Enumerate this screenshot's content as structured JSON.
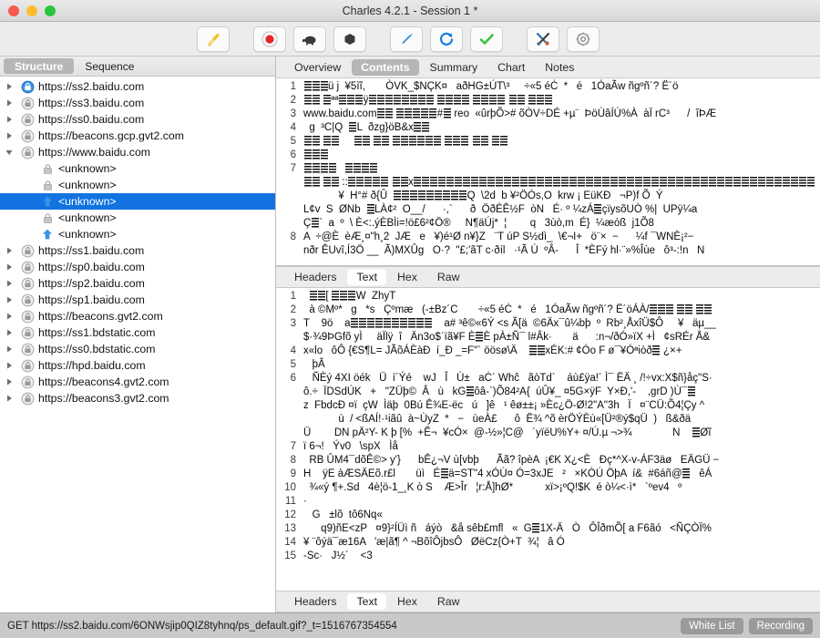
{
  "window": {
    "title": "Charles 4.2.1 - Session 1 *",
    "lights": [
      "close",
      "minimize",
      "zoom"
    ]
  },
  "toolbar": {
    "buttons": [
      {
        "name": "clear-session-button",
        "icon": "broom-icon",
        "label": "Clear"
      },
      {
        "name": "record-button",
        "icon": "record-icon",
        "label": "Start/Stop Recording"
      },
      {
        "name": "throttle-button",
        "icon": "turtle-icon",
        "label": "Throttle Settings"
      },
      {
        "name": "breakpoint-button",
        "icon": "hexagon-icon",
        "label": "Breakpoints"
      },
      {
        "name": "compose-button",
        "icon": "pen-icon",
        "label": "Compose"
      },
      {
        "name": "repeat-button",
        "icon": "refresh-icon",
        "label": "Repeat"
      },
      {
        "name": "validate-button",
        "icon": "checkmark-icon",
        "label": "Validate"
      },
      {
        "name": "tools-button",
        "icon": "tools-icon",
        "label": "Tools"
      },
      {
        "name": "settings-button",
        "icon": "gear-icon",
        "label": "Settings"
      }
    ]
  },
  "sidebar": {
    "segments": [
      {
        "label": "Structure",
        "active": true
      },
      {
        "label": "Sequence",
        "active": false
      }
    ],
    "tree": [
      {
        "label": "https://ss2.baidu.com",
        "icon": "globe-icon",
        "twisty": "collapsed",
        "depth": 0,
        "selected": false
      },
      {
        "label": "https://ss3.baidu.com",
        "icon": "lock-icon",
        "twisty": "collapsed",
        "depth": 0,
        "selected": false
      },
      {
        "label": "https://ss0.baidu.com",
        "icon": "lock-icon",
        "twisty": "collapsed",
        "depth": 0,
        "selected": false
      },
      {
        "label": "https://beacons.gcp.gvt2.com",
        "icon": "lock-icon",
        "twisty": "collapsed",
        "depth": 0,
        "selected": false
      },
      {
        "label": "https://www.baidu.com",
        "icon": "lock-icon",
        "twisty": "expanded",
        "depth": 0,
        "selected": false
      },
      {
        "label": "<unknown>",
        "icon": "lock-small-icon",
        "twisty": "none",
        "depth": 1,
        "selected": false
      },
      {
        "label": "<unknown>",
        "icon": "lock-small-icon",
        "twisty": "none",
        "depth": 1,
        "selected": false
      },
      {
        "label": "<unknown>",
        "icon": "upload-arrow-icon",
        "twisty": "none",
        "depth": 1,
        "selected": true
      },
      {
        "label": "<unknown>",
        "icon": "lock-small-icon",
        "twisty": "none",
        "depth": 1,
        "selected": false
      },
      {
        "label": "<unknown>",
        "icon": "upload-arrow-icon",
        "twisty": "none",
        "depth": 1,
        "selected": false
      },
      {
        "label": "https://ss1.baidu.com",
        "icon": "lock-icon",
        "twisty": "collapsed",
        "depth": 0,
        "selected": false
      },
      {
        "label": "https://sp0.baidu.com",
        "icon": "lock-icon",
        "twisty": "collapsed",
        "depth": 0,
        "selected": false
      },
      {
        "label": "https://sp2.baidu.com",
        "icon": "lock-icon",
        "twisty": "collapsed",
        "depth": 0,
        "selected": false
      },
      {
        "label": "https://sp1.baidu.com",
        "icon": "lock-icon",
        "twisty": "collapsed",
        "depth": 0,
        "selected": false
      },
      {
        "label": "https://beacons.gvt2.com",
        "icon": "lock-icon",
        "twisty": "collapsed",
        "depth": 0,
        "selected": false
      },
      {
        "label": "https://ss1.bdstatic.com",
        "icon": "lock-icon",
        "twisty": "collapsed",
        "depth": 0,
        "selected": false
      },
      {
        "label": "https://ss0.bdstatic.com",
        "icon": "lock-icon",
        "twisty": "collapsed",
        "depth": 0,
        "selected": false
      },
      {
        "label": "https://hpd.baidu.com",
        "icon": "lock-icon",
        "twisty": "collapsed",
        "depth": 0,
        "selected": false
      },
      {
        "label": "https://beacons4.gvt2.com",
        "icon": "lock-icon",
        "twisty": "collapsed",
        "depth": 0,
        "selected": false
      },
      {
        "label": "https://beacons3.gvt2.com",
        "icon": "lock-icon",
        "twisty": "collapsed",
        "depth": 0,
        "selected": false
      }
    ]
  },
  "main": {
    "tabs": [
      {
        "label": "Overview",
        "active": false
      },
      {
        "label": "Contents",
        "active": true
      },
      {
        "label": "Summary",
        "active": false
      },
      {
        "label": "Chart",
        "active": false
      },
      {
        "label": "Notes",
        "active": false
      }
    ],
    "upper": {
      "subtabs": [],
      "line_numbers": [
        "1",
        "2",
        "3",
        "4",
        "5",
        "6",
        "7",
        "",
        "",
        "",
        "",
        "8",
        ""
      ],
      "lines": [
        "§§§ü j  ¥5ìĩ,       ÒVK_$NÇK¤   aðHG±ÚT\\³     ÷«5 éĊ  *   é   1ÓaÃw ñgºñ´? Ë´ö",
        "§§ §ªª§§§ÿ§§§§§§§§ §§§§ §§§§ §§ §§§",
        "www.baidu.com§§ §§§§§#§ reo  «ûrþÕ># õÒV÷DÉ +µ¨  ÞöÙâÍÚ%À  àÏ rC³      /  îÞÆ",
        "  g  ³C|Q  §L  ðzg}öB&x§§",
        "§§ §§     §§ §§ §§§§§§ §§§ §§ §§",
        "§§§",
        "§§§§   §§§§",
        "§§ §§ ::§§§§§ §§x§§§§§§§§§§§§§§§§§§§§§§§§§§§§§§§§§§§§§§§§§§§§§§§§§",
        "            ¥  H°# ð{Û  §§§§§§§§§Q  \\2d  b ¥²ÖÓs,O  krw ¡ EüKÐ   ¬P)f Õ  Ý  ",
        "L¢v  S  ØNb  §LÀ¢²  O__/      ·,`      ð  ÖðÉÊ½F  òN   É· º ¼zÁ§çïysõUÒ %|  UPÿ¼a",
        "Ç§`  a  º  \\ È<:.ýÈBÌi=!ö£6²¢Ö®     N¶äÚj*  ¦        q   3ùò,m  É}  ¼æóß  j1Õ8",
        "A  ÷@È  èÆ¸¤\"h¸2  JÆ   e   ¥)é¹Ø n¥}Z   ¨T úP S½dì_  \\€¬I+   ö¨×  −      ¼f ¯WNÈ¡²−",
        "nðr ÊUvî,Í3Ö __  Ã)MXÛg   O·?  \"£;'ãT c·ðíl   ·¹Ã Ú  ºÂ-      Î  *ÈFý hl·¨»%Îùe   ô³-:!n   N"
      ]
    },
    "lower": {
      "subtabs_top": [
        {
          "label": "Headers",
          "active": false
        },
        {
          "label": "Text",
          "active": true
        },
        {
          "label": "Hex",
          "active": false
        },
        {
          "label": "Raw",
          "active": false
        }
      ],
      "subtabs_bottom": [
        {
          "label": "Headers",
          "active": false
        },
        {
          "label": "Text",
          "active": true
        },
        {
          "label": "Hex",
          "active": false
        },
        {
          "label": "Raw",
          "active": false
        }
      ],
      "line_numbers": [
        "1",
        "2",
        "3",
        "",
        "4",
        "5",
        "6",
        "",
        "",
        "",
        "",
        "7",
        "8",
        "9",
        "10",
        "11",
        "12",
        "13",
        "14",
        "15"
      ],
      "lines": [
        "  §§[ §§§W  ZhyT",
        "  à ©Mº*   g   *s   Çºmæ   (-±Bz´C       ÷«5 éĊ  *   é   1ÓaÃw ñgºñ´? Ë´öÁÀ/§§§ §§ §§",
        "T    9ö    a§§§§§§§§§§    a# ³ê©«6Ý <s Ã[ä  ©6Äx¯û¼bþ  º  Rb²¸ÅxîÜ$Ô     ¥   äµ__",
        "$·¾9ÞGfõ yÌ     äÏlÿ  î   Än3o$ˈïã¥F È§È pÀ±Ñ¯ l#Âk·       ä      :n¬/ðÓ»ïX +Ì   ¢sRÉr Å&",
        "x«lo   ôÔ {€S¶L= JÃõÁÈàÐ  í_Ð _=F\"` öösø\\Ä    §§xÉK:# ¢Óo F ø¯¥Óªiòð§ ¿×+",
        "   þÂ",
        "   ÑÈý 4XI öék   Ü  í´Ýé    wJ   Î   Ù±   aĊ´ Whĉ   ãòTd`    áù£ÿa!´ Ì¯ ËÄ ¸ /!÷vx:X$ñ}åç\"S·",
        "ô.÷  ÏDSdÚK   +   \"ZÜþ©  Â   ù   kG§ôâ-`)Õ84²A{  úÛ¥_ ¤5G×ÿF  Y×Ð,'-    ,grD )Ù¯§",
        "z  FbdcÐ ¤ï  çW  Ìäþ  0Bú Ê¾E-ëc   ú   ]ê   ¹ êø±±¡ »Èc¿Ö-Ø!2\"A\"3h   Ï   ¤¨CÜ:Õ4¦Çy ^",
        "            ù  / <ßAÍ!·¹iãû  à~ÙyZ  *   −   ùeÀ£      ô  Ë¾ ^õ èrÖÝÈù«[Ü²®ý$qÜ  )   ß&ðä",
        "Ü        DN pÄ²Y- K þ [%  +Ê¬  ¥cÓ×  @-½»¦C@   ´yïëU%Y+ ¤/Ú.µ ¬>¾              N    §Øĩ",
        "ï 6¬!   Ýv0   \\spX   Ìå",
        "  RB ÛM4¯dõÊ©> y'}      bÊ¿¬V ù[vbþ      Ãã? îpèA  ¡€K X¿<È   Ðç*^X-v-ÁF3äø   EÄGÜ −",
        "H    ÿE àÆSÄEõ.r£l       üì   É§ä=ST\"4 xÓÙ¤ Ó=3xJE   ²   ×KÒÚ ÖþA  í&  #6áñ@§   êÁ",
        "  ¾«ý ¶+.Sd   4è¦ö-1_¸K ò S    Æ>Îr   ¦r:Å]hØ*           xï>¡ºQ!$K  é ò¼<·ì*   `ºev4   º",
        "·",
        "   G   ±lõ  tô6Nq«",
        "      q9)ñE<zP   ¤9}²ÍÜì ñ   áýò   &å sêb£mfl   «  G§1X-Ä   Ò   ÔÎðmÕ[ a F6ãó   <ÑÇÒÏ%",
        "¥ ¨ôýä¯æ16A   'æ|ã¶ ^ ¬BõîÔjbsÔ   ØëCz{Ò+T  ¾¦   â Ó",
        "-Sc·   J½´    <3"
      ]
    }
  },
  "statusbar": {
    "request": "GET https://ss2.baidu.com/6ONWsjip0QIZ8tyhnq/ps_default.gif?_t=1516767354554",
    "buttons": [
      {
        "label": "White List",
        "name": "white-list-button"
      },
      {
        "label": "Recording",
        "name": "recording-button"
      }
    ]
  },
  "colors": {
    "selection": "#1273e0",
    "segment_active": "#b6b6b6",
    "status_bg": "#c9c9c9",
    "pill_bg": "#9a9a9a"
  }
}
